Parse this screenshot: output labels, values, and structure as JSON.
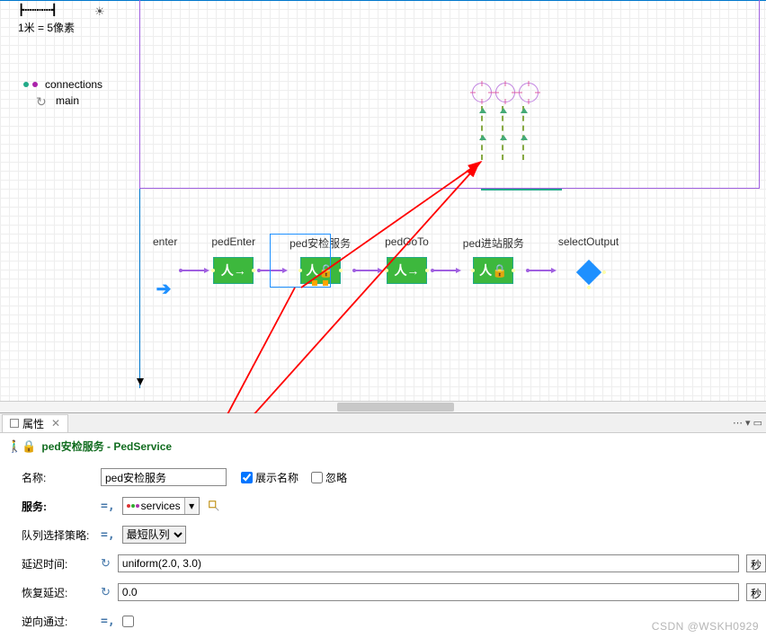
{
  "sidebar": {
    "ruler_marks": "┣┅┅┅┅┅┅┫",
    "ruler_sun": "☀",
    "scale_label": "1米 = 5像素",
    "connections_label": "connections",
    "main_label": "main"
  },
  "flow": {
    "enter": {
      "label": "enter"
    },
    "blocks": [
      {
        "label": "pedEnter",
        "icon": "人→"
      },
      {
        "label": "ped安检服务",
        "icon": "人🔒",
        "selected": true
      },
      {
        "label": "pedGoTo",
        "icon": "人→"
      },
      {
        "label": "ped进站服务",
        "icon": "人🔒"
      }
    ],
    "selectOutput": {
      "label": "selectOutput"
    }
  },
  "tabs": {
    "properties": "属性"
  },
  "panel": {
    "icon": "人",
    "title": "ped安检服务 - PedService"
  },
  "props": {
    "name_label": "名称:",
    "name_value": "ped安检服务",
    "show_name_label": "展示名称",
    "show_name_checked": true,
    "ignore_label": "忽略",
    "ignore_checked": false,
    "services_label": "服务:",
    "services_value": "services",
    "queue_label": "队列选择策略:",
    "queue_options": [
      "最短队列"
    ],
    "queue_value": "最短队列",
    "delay_label": "延迟时间:",
    "delay_value": "uniform(2.0, 3.0)",
    "delay_unit": "秒",
    "recover_label": "恢复延迟:",
    "recover_value": "0.0",
    "recover_unit": "秒",
    "reverse_label": "逆向通过:",
    "reverse_checked": false
  },
  "watermark": "CSDN @WSKH0929"
}
